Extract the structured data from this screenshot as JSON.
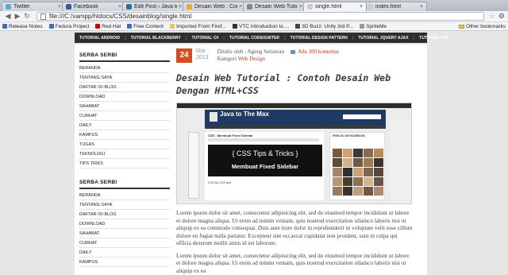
{
  "browser": {
    "tabs": [
      {
        "label": "Twitter",
        "color": "#5ea9dd",
        "active": false
      },
      {
        "label": "Facebook",
        "color": "#3b5998",
        "active": false
      },
      {
        "label": "Edit Post ‹ Java to The",
        "color": "#21759b",
        "active": false
      },
      {
        "label": "Desain Web : Contoh",
        "color": "#f4a62a",
        "active": false
      },
      {
        "label": "Desain Web Tutorial ·",
        "color": "#888888",
        "active": false
      },
      {
        "label": "single.html",
        "color": "#cccccc",
        "active": true
      },
      {
        "label": "index.html",
        "color": "#cccccc",
        "active": false
      }
    ],
    "url": "file:///C:/xampp/htdocs/CSS/desainblog/single.html",
    "bookmarks": [
      {
        "label": "Release Notes",
        "color": "#3c6eb4"
      },
      {
        "label": "Fedora Project",
        "color": "#3c6eb4"
      },
      {
        "label": "Red Hat",
        "color": "#cc0000"
      },
      {
        "label": "Free Content",
        "color": "#3c6eb4"
      },
      {
        "label": "Imported From Firef...",
        "color": "#e5c36a"
      },
      {
        "label": "VTC Introduction to ...",
        "color": "#333333"
      },
      {
        "label": "3D Buzz: Unity 3rd P...",
        "color": "#444444"
      },
      {
        "label": "SpriteMe",
        "color": "#999999"
      }
    ],
    "other_bookmarks": "Other bookmarks"
  },
  "topnav": [
    "TUTORIAL ANDROID",
    "TUTORIAL BLACKBERRY",
    "TUTORIAL C#",
    "TUTORIAL CODEIGNITER",
    "TUTORIAL DESIGN PATTERN",
    "TUTORIAL JQUERY AJAX",
    "TUTORIAL PHP"
  ],
  "sidebar": {
    "sections": [
      {
        "title": "SERBA SERBI",
        "items": [
          "BERANDA",
          "TENTANG SAYA",
          "DAFTAR ISI BLOG",
          "DOWNLOAD",
          "SAHABAT",
          "CURHAT",
          "DAILY",
          "KAMPUS",
          "TUGAS",
          "TEKNOLOGI",
          "TIPS TRIKS"
        ]
      },
      {
        "title": "SERBA SERBI",
        "items": [
          "BERANDA",
          "TENTANG SAYA",
          "DAFTAR ISI BLOG",
          "DOWNLOAD",
          "SAHABAT",
          "CURHAT",
          "DAILY",
          "KAMPUS"
        ]
      }
    ]
  },
  "post": {
    "day": "24",
    "month": "Mar",
    "year": "2013",
    "author_prefix": "Ditulis oleh : Agung Setiawan",
    "comments": "Ada 100 komentar",
    "category_prefix": "Kategori",
    "category": "Web Design",
    "title": "Desain Web Tutorial : Contoh Desain Web Dengan HTML+CSS",
    "image": {
      "site_title": "Java to The Max",
      "post_title": "CSS : Membuat Fixed Sidebar",
      "banner_line1": "{ CSS Tips & Tricks }",
      "banner_line2": "Membuat Fixed Sidebar",
      "caption": "CSS tips CSS tips!",
      "fb_title": "FIND US ON FACEBOOK"
    },
    "paragraphs": [
      "Lorem ipsum dolor sit amet, consectetur adipisicing elit, sed do eiusmod tempor incididunt ut labore et dolore magna aliqua. Ut enim ad minim veniam, quis nostrud exercitation ullamco laboris nisi ut aliquip ex ea commodo consequat. Duis aute irure dolor in reprehenderit in voluptate velit esse cillum dolore eu fugiat nulla pariatur. Excepteur sint occaecat cupidatat non proident, sunt in culpa qui officia deserunt mollit anim id est laborum.",
      "Lorem ipsum dolor sit amet, consectetur adipisicing elit, sed do eiusmod tempor incididunt ut labore et dolore magna aliqua. Ut enim ad minim veniam, quis nostrud exercitation ullamco laboris nisi ut aliquip ex ea"
    ]
  }
}
